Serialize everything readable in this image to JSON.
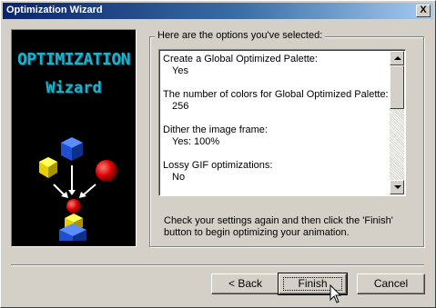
{
  "window": {
    "title": "Optimization Wizard",
    "close_label": "X"
  },
  "side": {
    "line1": "OPTIMIZATION",
    "line2": "Wizard"
  },
  "group": {
    "label": "Here are the options you've selected:",
    "items": [
      {
        "label": "Create a Global Optimized Palette:",
        "value": "Yes"
      },
      {
        "label": "The number of colors for Global Optimized Palette:",
        "value": "256"
      },
      {
        "label": "Dither the image frame:",
        "value": "Yes: 100%"
      },
      {
        "label": "Lossy GIF optimizations:",
        "value": "No"
      }
    ],
    "instructions": "Check your settings again and then click the 'Finish' button to begin optimizing your animation."
  },
  "buttons": {
    "back": "< Back",
    "finish": "Finish",
    "cancel": "Cancel"
  },
  "icons": {
    "close": "close-icon",
    "scroll_up": "scroll-up-icon",
    "scroll_down": "scroll-down-icon",
    "cursor": "mouse-pointer-icon"
  }
}
